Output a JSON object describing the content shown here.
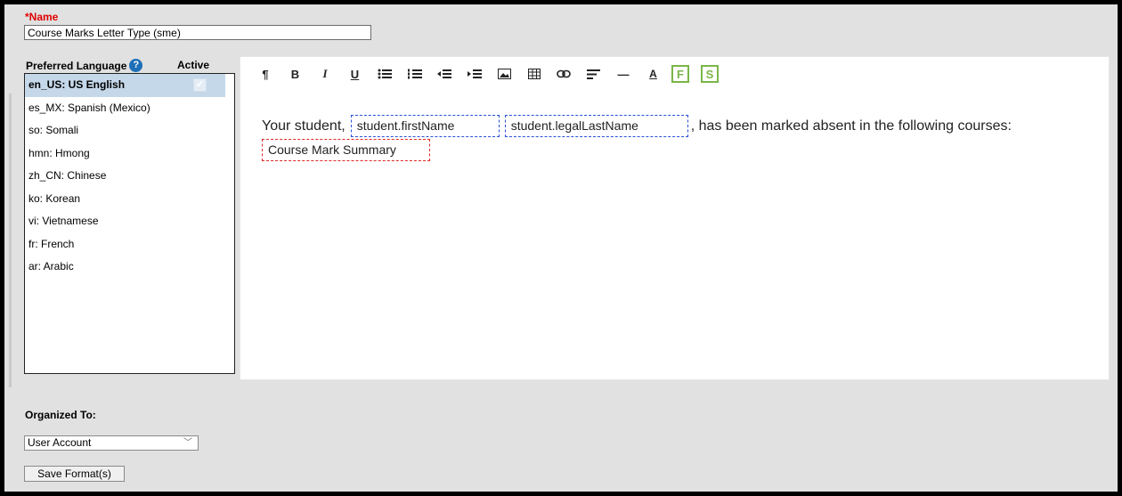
{
  "name": {
    "label": "*Name",
    "value": "Course Marks Letter Type (sme)"
  },
  "languages": {
    "header": "Preferred Language",
    "active_header": "Active",
    "items": [
      {
        "label": "en_US: US English",
        "selected": true,
        "active": true
      },
      {
        "label": "es_MX: Spanish (Mexico)"
      },
      {
        "label": "so: Somali"
      },
      {
        "label": "hmn: Hmong"
      },
      {
        "label": "zh_CN: Chinese"
      },
      {
        "label": "ko: Korean"
      },
      {
        "label": "vi: Vietnamese"
      },
      {
        "label": "fr: French"
      },
      {
        "label": "ar: Arabic"
      }
    ]
  },
  "toolbar": {
    "icons": [
      "paragraph-icon",
      "bold-icon",
      "italic-icon",
      "underline-icon",
      "unordered-list-icon",
      "ordered-list-icon",
      "outdent-icon",
      "indent-icon",
      "image-icon",
      "table-icon",
      "link-icon",
      "align-icon",
      "horizontal-rule-icon",
      "font-color-icon",
      "field-icon",
      "subreport-icon"
    ],
    "glyphs": {
      "paragraph": "¶",
      "bold": "B",
      "italic": "I",
      "underline": "U",
      "ul": "☰",
      "ol": "☰",
      "outdent": "⇤",
      "indent": "⇥",
      "image": "▭",
      "table": "▦",
      "link": "⊖",
      "align": "≡",
      "hr": "—",
      "color": "A",
      "field": "F",
      "subreport": "S"
    }
  },
  "editor": {
    "text_before": "Your student,",
    "field_first": "student.firstName",
    "field_last": "student.legalLastName",
    "text_after": ", has been marked absent in the following courses:",
    "summary": "Course Mark Summary"
  },
  "organized": {
    "label": "Organized To:",
    "value": "User Account"
  },
  "save_button": "Save Format(s)",
  "colors": {
    "required": "#e00000",
    "selected_row": "#c5d8ea",
    "field_border": "#2850d8",
    "summary_border": "#e02828",
    "accent_green": "#7ab648"
  }
}
